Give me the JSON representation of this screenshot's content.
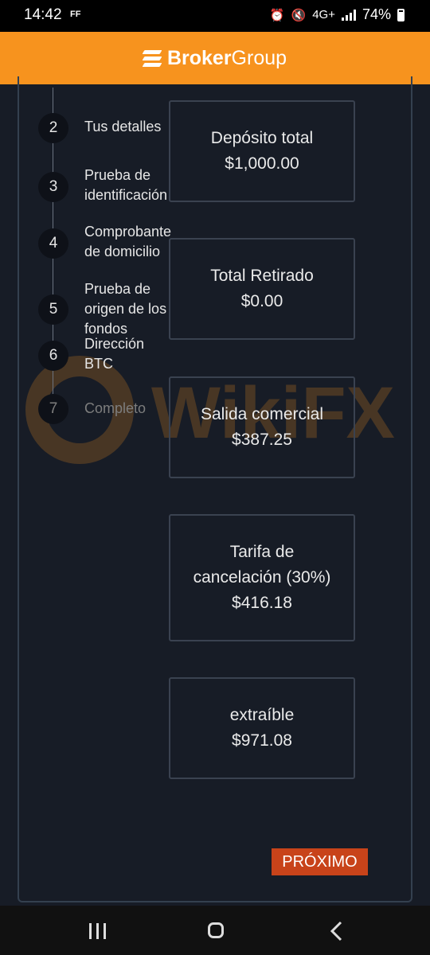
{
  "status_bar": {
    "time": "14:42",
    "indicator": "FF",
    "network": "4G+",
    "battery": "74%"
  },
  "header": {
    "logo_part1": "Broker",
    "logo_part2": "Group",
    "color": "#f7931e"
  },
  "steps": [
    {
      "number": "2",
      "label_lines": [
        "Tus detalles"
      ]
    },
    {
      "number": "3",
      "label_lines": [
        "Prueba de",
        "identificación"
      ]
    },
    {
      "number": "4",
      "label_lines": [
        "Comprobante",
        "de domicilio"
      ]
    },
    {
      "number": "5",
      "label_lines": [
        "Prueba de",
        "origen de los",
        "fondos"
      ]
    },
    {
      "number": "6",
      "label_lines": [
        "Dirección",
        "BTC"
      ]
    },
    {
      "number": "7",
      "label_lines": [
        "Completo"
      ]
    }
  ],
  "cards": {
    "deposit": {
      "label": "Depósito total",
      "value": "$1,000.00"
    },
    "withdrawn": {
      "label": "Total Retirado",
      "value": "$0.00"
    },
    "trade_output": {
      "label": "Salida comercial",
      "value": "$387.25"
    },
    "cancel_fee": {
      "label_line1": "Tarifa de",
      "label_line2": "cancelación (30%)",
      "value": "$416.18"
    },
    "withdrawable": {
      "label": "extraíble",
      "value": "$971.08"
    }
  },
  "next_button": "PRÓXIMO",
  "watermark": "WikiFX",
  "colors": {
    "accent_button": "#c8431a",
    "background": "#171c26"
  }
}
